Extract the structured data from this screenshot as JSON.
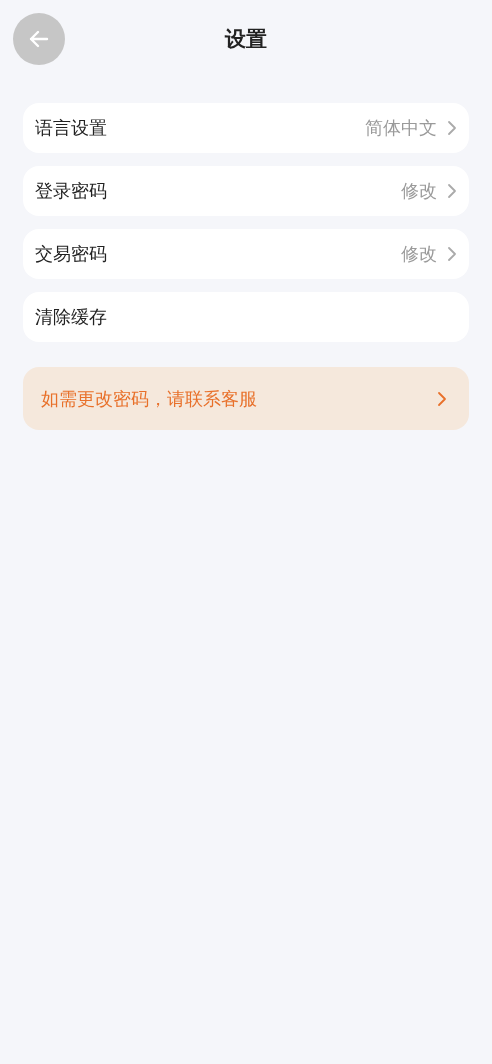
{
  "header": {
    "title": "设置"
  },
  "rows": [
    {
      "label": "语言设置",
      "value": "简体中文"
    },
    {
      "label": "登录密码",
      "value": "修改"
    },
    {
      "label": "交易密码",
      "value": "修改"
    },
    {
      "label": "清除缓存"
    }
  ],
  "notice": {
    "text": "如需更改密码，请联系客服"
  }
}
